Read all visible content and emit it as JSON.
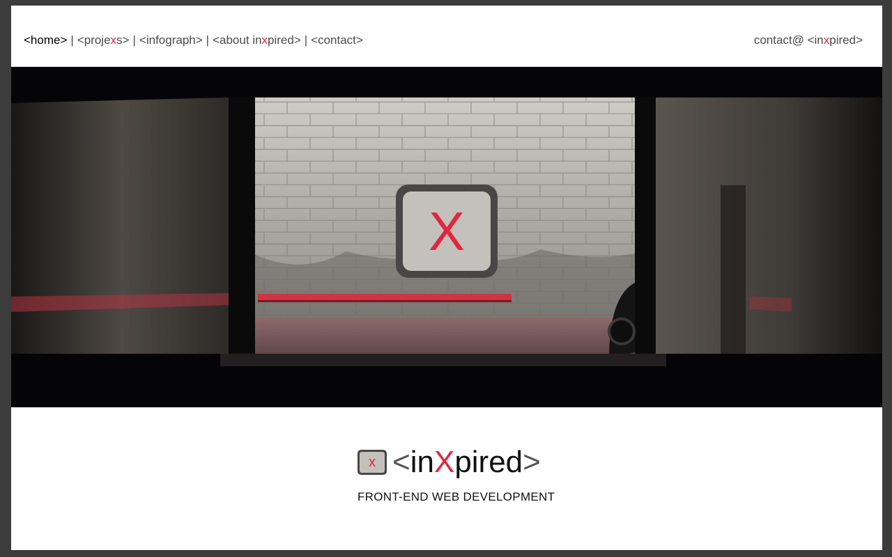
{
  "nav": {
    "items": [
      {
        "label": "<home>",
        "active": true
      },
      {
        "pre": "<proje",
        "x": "x",
        "post": "s>"
      },
      {
        "label": "<infograph>"
      },
      {
        "pre": "<about in",
        "x": "x",
        "post": "pired>"
      },
      {
        "label": "<contact>"
      }
    ],
    "separator": "|"
  },
  "contact": {
    "pre": "contact@ <in",
    "x": "x",
    "post": "pired>"
  },
  "hero": {
    "badge_letter": "X"
  },
  "logo": {
    "icon_letter": "x",
    "open_bracket": "<",
    "pre": "in",
    "x": "X",
    "post": "pired",
    "close_bracket": ">"
  },
  "tagline": "FRONT-END WEB DEVELOPMENT",
  "colors": {
    "accent": "#e2263e",
    "frame": "#3c3c3c",
    "badge_border": "#4a4647",
    "badge_fill": "#c4c1bd"
  }
}
